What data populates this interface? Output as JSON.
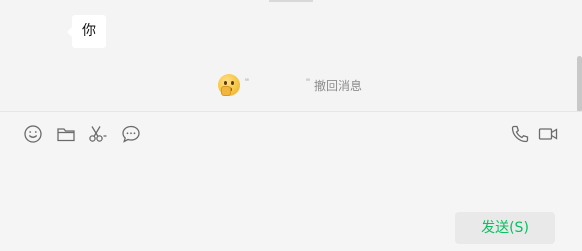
{
  "chat": {
    "bubble_text": "你",
    "recall_notice": {
      "quote_open": "\"",
      "quote_close": "\"",
      "text": "撤回消息",
      "emoji_icon": "shush-emoji-icon"
    }
  },
  "toolbar": {
    "icons": [
      "emoji-icon",
      "folder-icon",
      "scissors-icon",
      "chat-history-icon",
      "phone-icon",
      "video-icon"
    ]
  },
  "send_button": {
    "label": "发送(S)"
  },
  "colors": {
    "send_text": "#07c160",
    "send_bg": "#e9e9e9",
    "background": "#f5f5f5",
    "icon": "#6b6b6b"
  }
}
